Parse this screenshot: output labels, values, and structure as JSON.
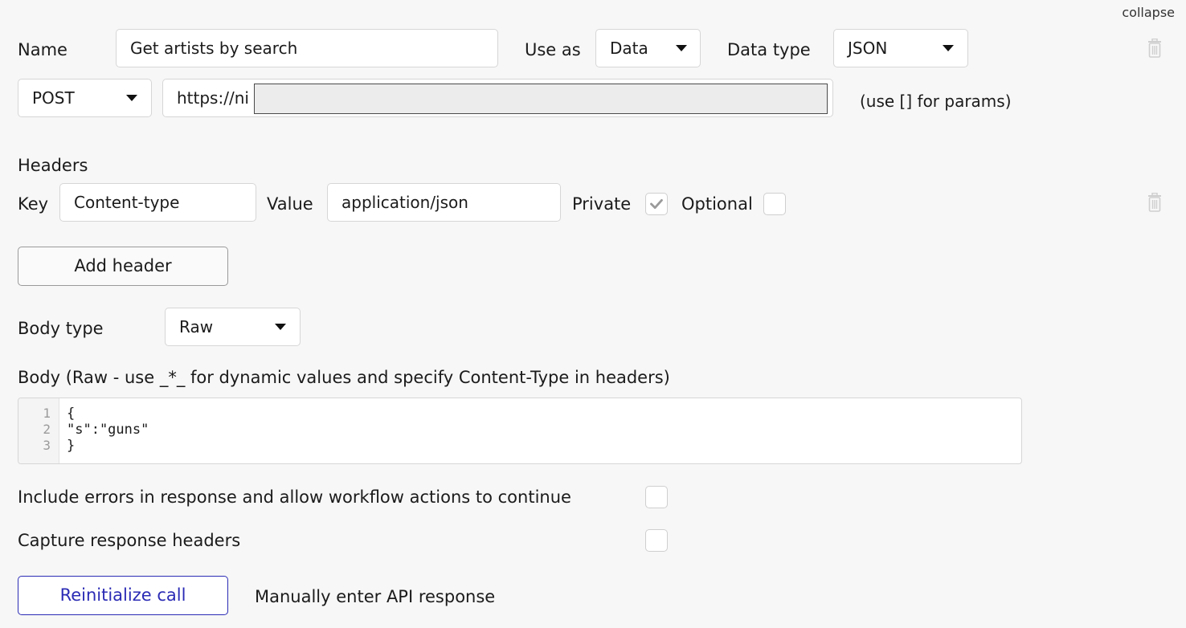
{
  "collapse_label": "collapse",
  "name": {
    "label": "Name",
    "value": "Get artists by search"
  },
  "use_as": {
    "label": "Use as",
    "value": "Data"
  },
  "data_type": {
    "label": "Data type",
    "value": "JSON"
  },
  "method": {
    "value": "POST"
  },
  "url": {
    "value": "https://ni",
    "hint": "(use [] for params)"
  },
  "headers": {
    "title": "Headers",
    "key_label": "Key",
    "key_value": "Content-type",
    "value_label": "Value",
    "value_value": "application/json",
    "private_label": "Private",
    "optional_label": "Optional",
    "private_checked": true,
    "optional_checked": false
  },
  "add_header_label": "Add header",
  "body_type": {
    "label": "Body type",
    "value": "Raw"
  },
  "body": {
    "label": "Body (Raw - use _*_ for dynamic values and specify Content-Type in headers)",
    "lines": [
      {
        "num": "1",
        "text": "{"
      },
      {
        "num": "2",
        "text": "\"s\":\"guns\""
      },
      {
        "num": "3",
        "text": "}"
      }
    ]
  },
  "options": {
    "include_errors_label": "Include errors in response and allow workflow actions to continue",
    "include_errors_checked": false,
    "capture_headers_label": "Capture response headers",
    "capture_headers_checked": false
  },
  "reinitialize_label": "Reinitialize call",
  "manual_label": "Manually enter API response",
  "colors": {
    "accent": "#2b2bb5",
    "redaction": "#ececec"
  }
}
